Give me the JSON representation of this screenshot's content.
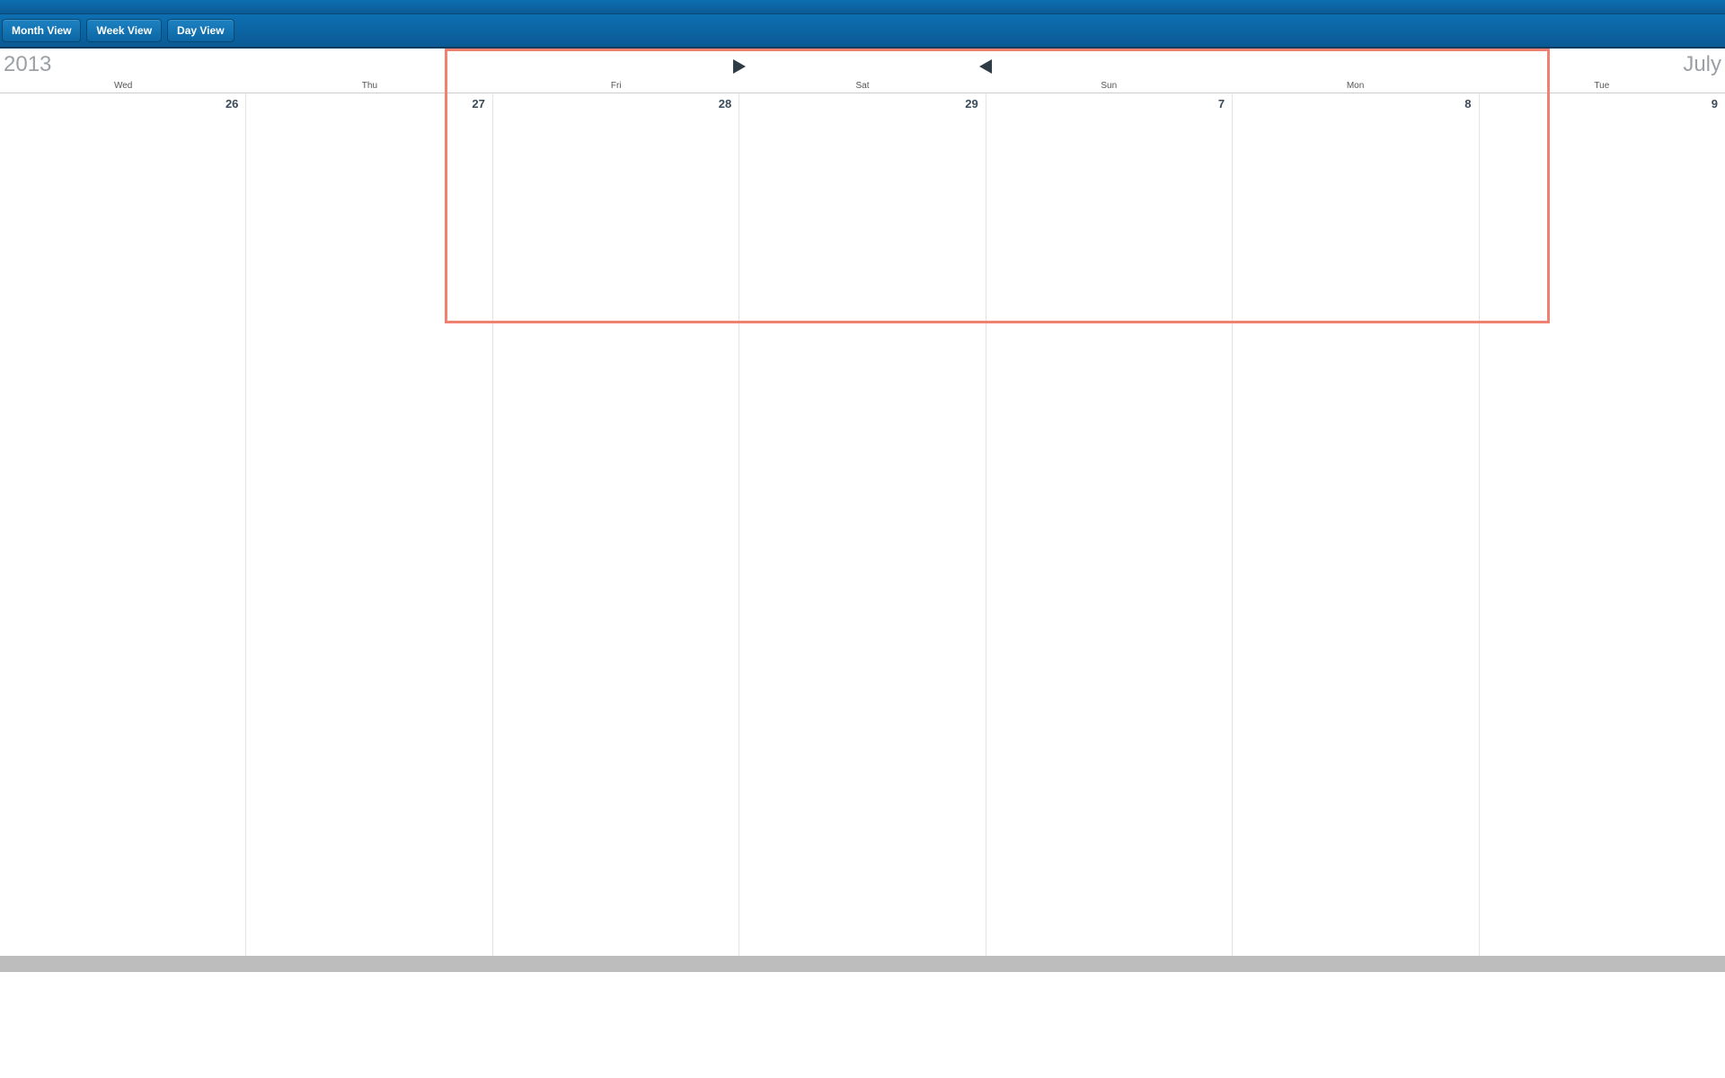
{
  "toolbar": {
    "month_view": "Month View",
    "week_view": "Week View",
    "day_view": "Day View"
  },
  "header": {
    "left_label": "2013",
    "right_label": "July"
  },
  "days": [
    {
      "short": "Wed",
      "num": "26"
    },
    {
      "short": "Thu",
      "num": "27"
    },
    {
      "short": "Fri",
      "num": "28"
    },
    {
      "short": "Sat",
      "num": "29"
    },
    {
      "short": "Sun",
      "num": "7"
    },
    {
      "short": "Mon",
      "num": "8"
    },
    {
      "short": "Tue",
      "num": "9"
    }
  ]
}
